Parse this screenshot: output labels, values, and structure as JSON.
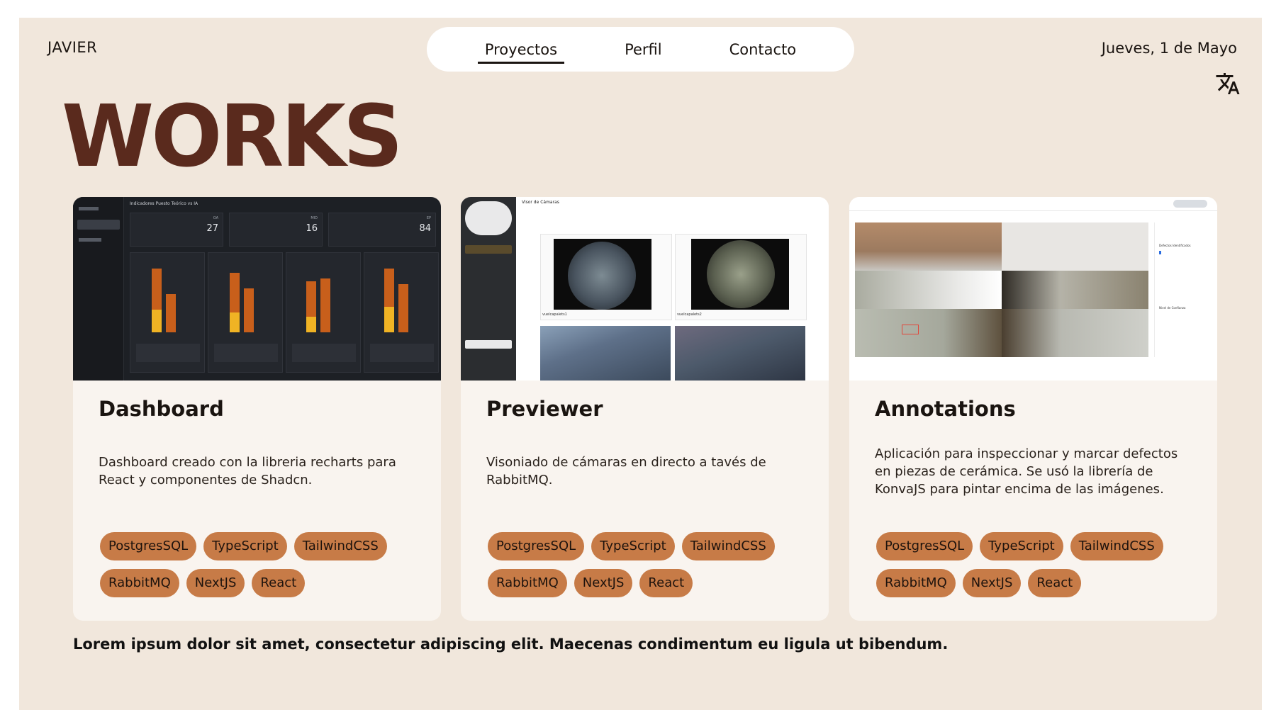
{
  "header": {
    "brand": "JAVIER",
    "nav": [
      {
        "label": "Proyectos",
        "active": true
      },
      {
        "label": "Perfil",
        "active": false
      },
      {
        "label": "Contacto",
        "active": false
      }
    ],
    "date": "Jueves, 1 de Mayo",
    "translate_icon": "translate-icon"
  },
  "page_title": "WORKS",
  "cards": [
    {
      "title": "Dashboard",
      "description": "Dashboard creado con la libreria recharts para React y componentes de Shadcn.",
      "tags": [
        "PostgresSQL",
        "TypeScript",
        "TailwindCSS",
        "RabbitMQ",
        "NextJS",
        "React"
      ],
      "thumbnail": {
        "header": "Indicadores Puesto Teórico vs IA",
        "kpis": [
          {
            "label": "OA",
            "value": "27"
          },
          {
            "label": "MID",
            "value": "16"
          },
          {
            "label": "EP",
            "value": "84"
          }
        ]
      }
    },
    {
      "title": "Previewer",
      "description": "Visoniado de cámaras en directo a tavés de RabbitMQ.",
      "tags": [
        "PostgresSQL",
        "TypeScript",
        "TailwindCSS",
        "RabbitMQ",
        "NextJS",
        "React"
      ],
      "thumbnail": {
        "header": "Visor de Cámaras",
        "cams": [
          "vuelcapalets1",
          "vuelcapalets2"
        ]
      }
    },
    {
      "title": "Annotations",
      "description": "Aplicación para inspeccionar y marcar defectos en piezas de cerámica. Se usó la librería de KonvaJS para pintar encima de las imágenes.",
      "tags": [
        "PostgresSQL",
        "TypeScript",
        "TailwindCSS",
        "RabbitMQ",
        "NextJS",
        "React"
      ],
      "thumbnail": {
        "side_labels": [
          "Defectos Identificados",
          "Nivel de Confianza"
        ]
      }
    }
  ],
  "footer": {
    "text": "Lorem ipsum dolor sit amet, consectetur adipiscing elit. Maecenas condimentum eu ligula ut bibendum."
  },
  "colors": {
    "background": "#f1e7dc",
    "title": "#5a2a1d",
    "card": "#f9f4ef",
    "tag": "#c77b47"
  }
}
